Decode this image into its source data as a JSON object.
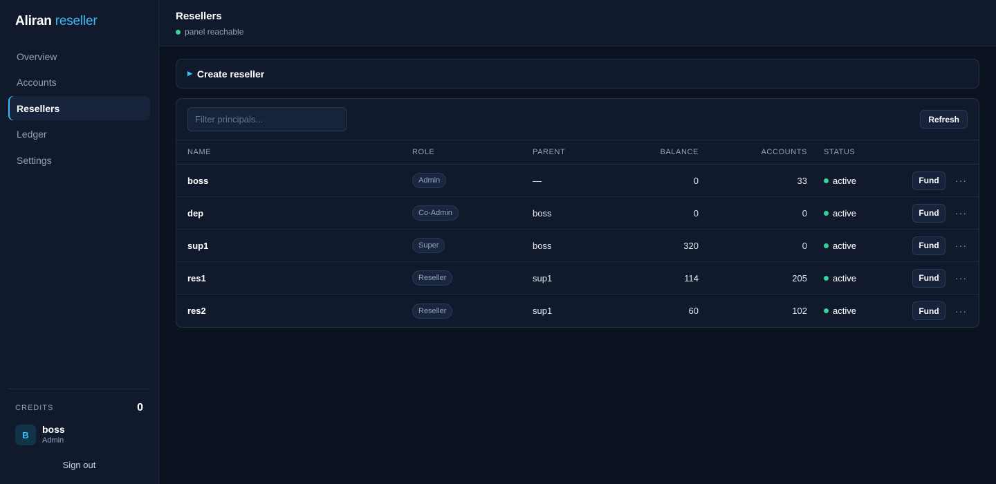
{
  "brand": {
    "name": "Aliran",
    "suffix": "reseller"
  },
  "nav": [
    {
      "label": "Overview",
      "active": false
    },
    {
      "label": "Accounts",
      "active": false
    },
    {
      "label": "Resellers",
      "active": true
    },
    {
      "label": "Ledger",
      "active": false
    },
    {
      "label": "Settings",
      "active": false
    }
  ],
  "credits": {
    "label": "CREDITS",
    "value": "0"
  },
  "user": {
    "initial": "B",
    "name": "boss",
    "role": "Admin"
  },
  "signout_label": "Sign out",
  "header": {
    "title": "Resellers",
    "status": "panel reachable",
    "status_color": "#34d399"
  },
  "create": {
    "label": "Create reseller"
  },
  "filter": {
    "placeholder": "Filter principals...",
    "value": ""
  },
  "refresh_label": "Refresh",
  "table": {
    "columns": [
      "NAME",
      "ROLE",
      "PARENT",
      "BALANCE",
      "ACCOUNTS",
      "STATUS"
    ],
    "rows": [
      {
        "name": "boss",
        "role": "Admin",
        "parent": "—",
        "balance": "0",
        "accounts": "33",
        "status": "active"
      },
      {
        "name": "dep",
        "role": "Co-Admin",
        "parent": "boss",
        "balance": "0",
        "accounts": "0",
        "status": "active"
      },
      {
        "name": "sup1",
        "role": "Super",
        "parent": "boss",
        "balance": "320",
        "accounts": "0",
        "status": "active"
      },
      {
        "name": "res1",
        "role": "Reseller",
        "parent": "sup1",
        "balance": "114",
        "accounts": "205",
        "status": "active"
      },
      {
        "name": "res2",
        "role": "Reseller",
        "parent": "sup1",
        "balance": "60",
        "accounts": "102",
        "status": "active"
      }
    ],
    "fund_label": "Fund",
    "more_label": "···"
  },
  "colors": {
    "accent": "#38bdf8",
    "active_status": "#34d399",
    "background": "#0b1220",
    "panel": "#111a2c"
  }
}
